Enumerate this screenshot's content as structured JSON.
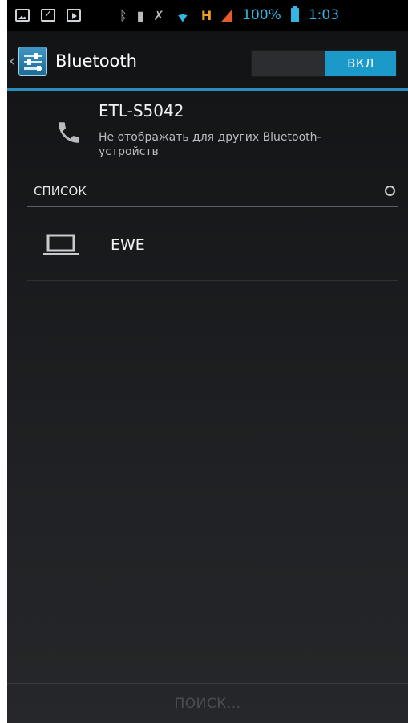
{
  "status_bar": {
    "battery_text": "100%",
    "time": "1:03",
    "network_label": "H",
    "icons": [
      "photo-icon",
      "calendar-icon",
      "video-icon",
      "bluetooth-icon",
      "sd-card-icon",
      "mute-icon",
      "wifi-icon",
      "network-icon",
      "signal-icon",
      "battery-icon"
    ],
    "accent": "#33b5e5"
  },
  "action_bar": {
    "title": "Bluetooth",
    "toggle_on_label": "ВКЛ",
    "accent": "#1b99c9"
  },
  "device": {
    "name": "ETL-S5042",
    "visibility_text": "Не отображать для других Bluetooth-устройств"
  },
  "list": {
    "header": "СПИСОК",
    "items": [
      {
        "label": "EWE",
        "icon": "laptop-icon"
      }
    ]
  },
  "bottom": {
    "search_label": "ПОИСК..."
  }
}
